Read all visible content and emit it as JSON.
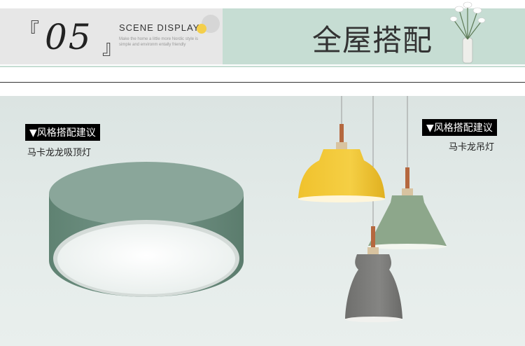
{
  "header": {
    "bracket_open": "『",
    "number": "05",
    "bracket_close": "』",
    "scene_label": "SCENE DISPLAY",
    "subtitle": "Make the home a little more Nordic style is simple and environm entally friendly",
    "title": "全屋搭配"
  },
  "left_product": {
    "tag": "▼风格搭配建议",
    "caption": "马卡龙龙吸顶灯"
  },
  "right_product": {
    "tag": "▼风格搭配建议",
    "caption": "马卡龙吊灯"
  },
  "colors": {
    "header_left_bg": "#e7e7e7",
    "header_right_bg": "#c6ddd3",
    "accent_yellow": "#f4cf4b",
    "ceiling_lamp_green": "#6e8f7f",
    "pendant_yellow": "#efc12f",
    "pendant_green": "#8ea68b",
    "pendant_gray": "#7b7b79"
  }
}
